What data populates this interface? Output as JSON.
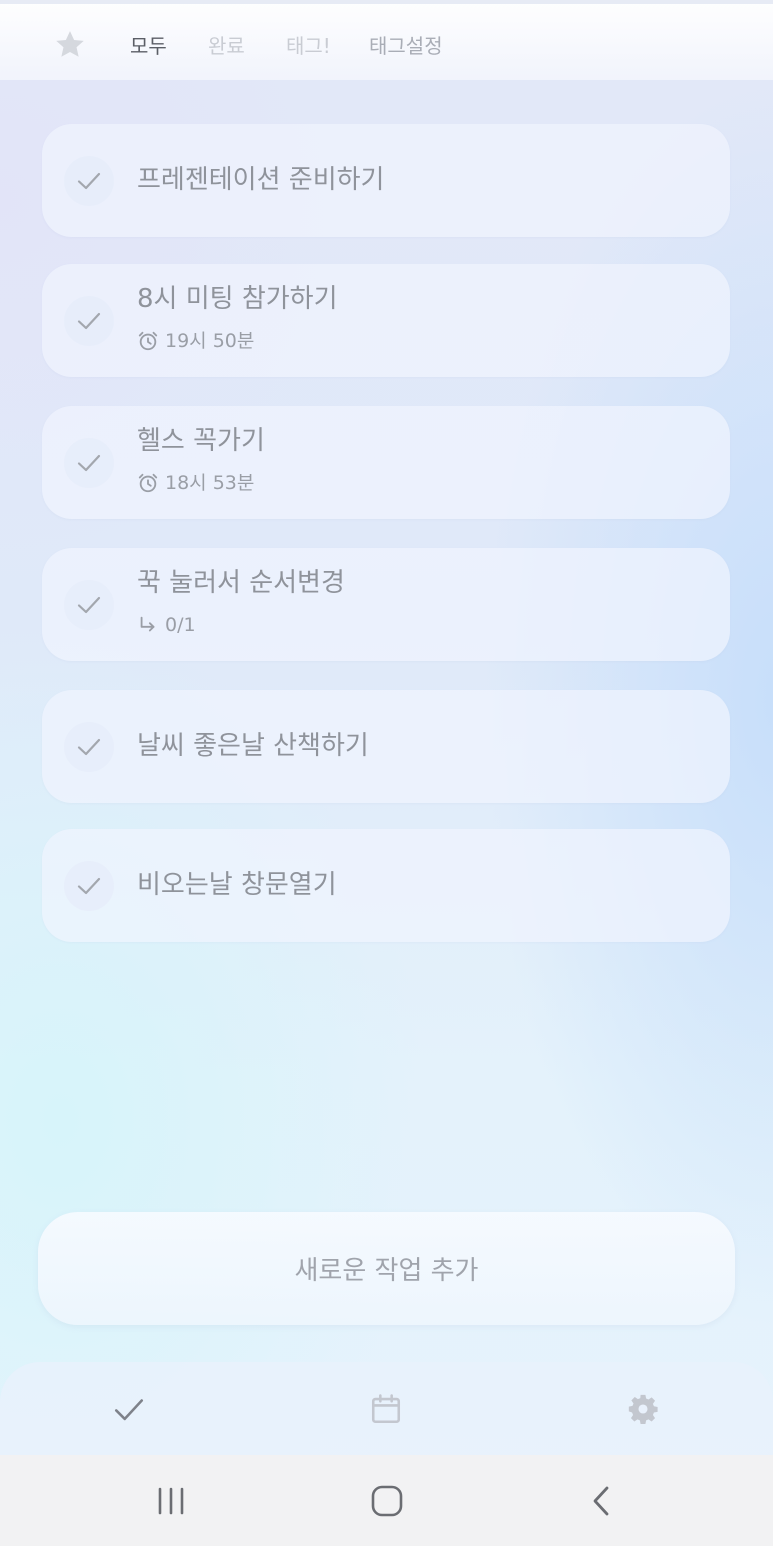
{
  "filter_tabs": [
    {
      "label": "모두",
      "state": "active"
    },
    {
      "label": "완료",
      "state": "dim"
    },
    {
      "label": "태그!",
      "state": "dim"
    },
    {
      "label": "태그설정",
      "state": "mid"
    }
  ],
  "tasks": [
    {
      "title": "프레젠테이션 준비하기"
    },
    {
      "title": "8시 미팅 참가하기",
      "sub": "19시 50분",
      "sub_icon": "alarm-icon"
    },
    {
      "title": "헬스 꼭가기",
      "sub": "18시 53분",
      "sub_icon": "alarm-icon"
    },
    {
      "title": "꾹 눌러서 순서변경",
      "sub": "0/1",
      "sub_icon": "subtask-arrow-icon"
    },
    {
      "title": "날씨 좋은날 산책하기"
    },
    {
      "title": "비오는날 창문열기"
    }
  ],
  "add_task": {
    "label": "새로운 작업 추가"
  },
  "bottom_nav": [
    {
      "icon": "check-icon"
    },
    {
      "icon": "calendar-icon"
    },
    {
      "icon": "gear-icon"
    }
  ],
  "system_nav": [
    {
      "icon": "recent-apps-icon"
    },
    {
      "icon": "home-icon"
    },
    {
      "icon": "back-icon"
    }
  ],
  "colors": {
    "text_primary": "#8f939b",
    "tab_active": "#5b5e66",
    "tab_dim": "#c9ccd3",
    "card_bg": "#f0f4fd",
    "system_nav_bg": "#f2f2f3"
  }
}
